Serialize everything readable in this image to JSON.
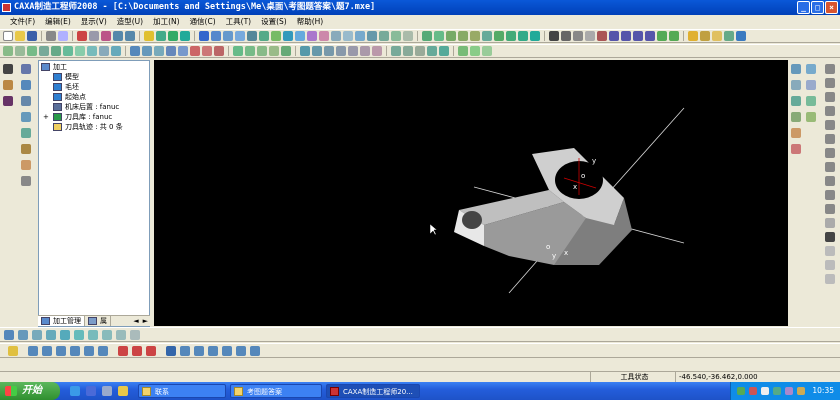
{
  "window": {
    "title": "CAXA制造工程师2008  - [C:\\Documents and Settings\\Me\\桌面\\考图题答案\\题7.mxe]",
    "minimize": "_",
    "maximize": "□",
    "close": "×"
  },
  "menu": [
    "文件(F)",
    "编辑(E)",
    "显示(V)",
    "造型(U)",
    "加工(N)",
    "通信(C)",
    "工具(T)",
    "设置(S)",
    "帮助(H)"
  ],
  "tree": {
    "root": "加工",
    "items": [
      {
        "label": "模型",
        "expander": "",
        "icon_color": "#2f7fd0"
      },
      {
        "label": "毛坯",
        "expander": "",
        "icon_color": "#2f7fd0"
      },
      {
        "label": "起始点",
        "expander": "",
        "icon_color": "#2f7fd0"
      },
      {
        "label": "机床后置 : fanuc",
        "expander": "",
        "icon_color": "#5a6f9a"
      },
      {
        "label": "刀具库 : fanuc",
        "expander": "+",
        "icon_color": "#2a9a4a"
      },
      {
        "label": "刀具轨迹 : 共 0 条",
        "expander": "",
        "icon_color": "#f0d060"
      }
    ],
    "tabs": [
      "加工管理",
      "属"
    ],
    "scroll_left": "◄",
    "scroll_right": "►"
  },
  "viewport": {
    "axis_labels": [
      "y",
      "o",
      "x",
      "o",
      "y",
      "x"
    ]
  },
  "status": {
    "state": "工具状态",
    "coords": "-46.540,-36.462,0.000"
  },
  "taskbar": {
    "start": "开始",
    "tasks": [
      "联系",
      "考图题答案",
      "CAXA制造工程师20..."
    ],
    "clock": "10:35"
  },
  "colors": {
    "title_bar": "#0a58d8",
    "viewport_bg": "#000000",
    "part": "#d8d8d8",
    "taskbar": "#245edb",
    "start_button": "#3c9a3c"
  }
}
